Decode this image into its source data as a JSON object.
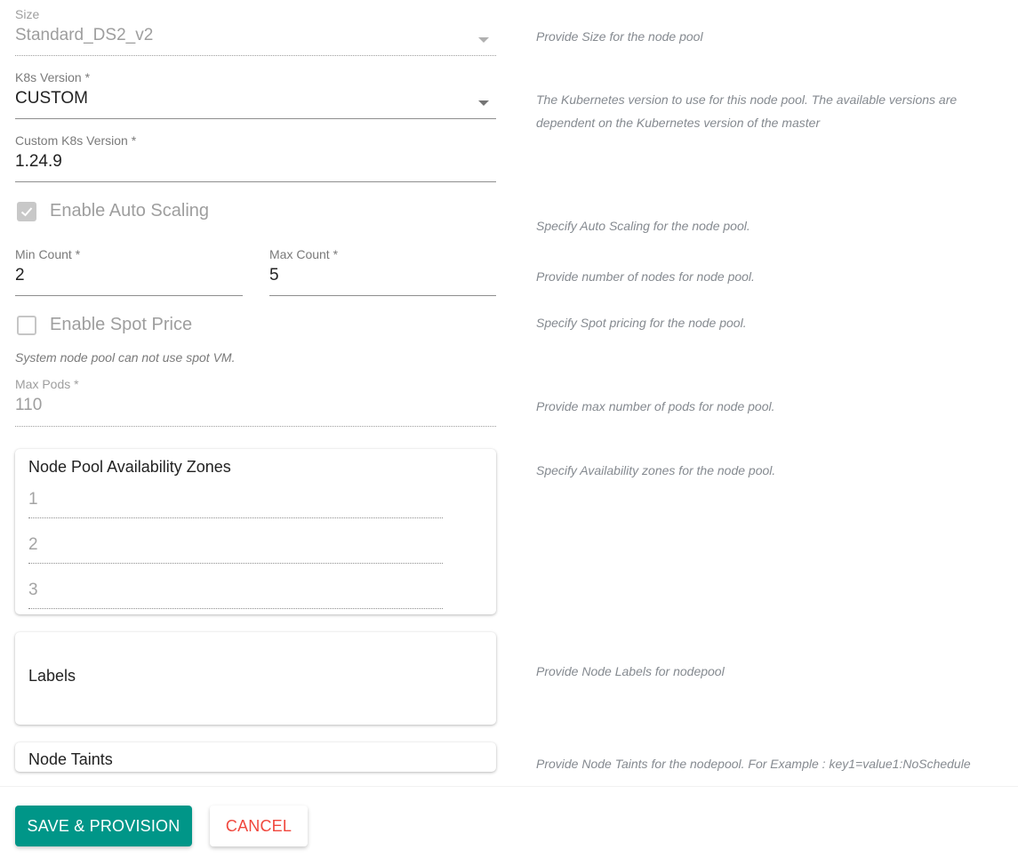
{
  "form": {
    "size": {
      "label": "Size",
      "value": "Standard_DS2_v2",
      "help": "Provide Size for the node pool"
    },
    "k8s_version": {
      "label": "K8s Version *",
      "value": "CUSTOM",
      "help": "The Kubernetes version to use for this node pool. The available versions are dependent on the Kubernetes version of the master"
    },
    "custom_k8s_version": {
      "label": "Custom K8s Version *",
      "value": "1.24.9"
    },
    "auto_scaling": {
      "label": "Enable Auto Scaling",
      "checked": true,
      "help": "Specify Auto Scaling for the node pool."
    },
    "min_count": {
      "label": "Min Count *",
      "value": "2"
    },
    "max_count": {
      "label": "Max Count *",
      "value": "5",
      "help": "Provide number of nodes for node pool."
    },
    "spot_price": {
      "label": "Enable Spot Price",
      "checked": false,
      "note": "System node pool can not use spot VM.",
      "help": "Specify Spot pricing for the node pool."
    },
    "max_pods": {
      "label": "Max Pods *",
      "value": "110",
      "help": "Provide max number of pods for node pool."
    },
    "availability_zones": {
      "title": "Node Pool Availability Zones",
      "zones": [
        "1",
        "2",
        "3"
      ],
      "help": "Specify Availability zones for the node pool."
    },
    "labels": {
      "title": "Labels",
      "help": "Provide Node Labels for nodepool"
    },
    "node_taints": {
      "title": "Node Taints",
      "help": "Provide Node Taints for the nodepool. For Example : key1=value1:NoSchedule"
    }
  },
  "footer": {
    "save_label": "SAVE & PROVISION",
    "cancel_label": "CANCEL"
  },
  "colors": {
    "primary": "#009688",
    "cancel": "#f0473d"
  }
}
